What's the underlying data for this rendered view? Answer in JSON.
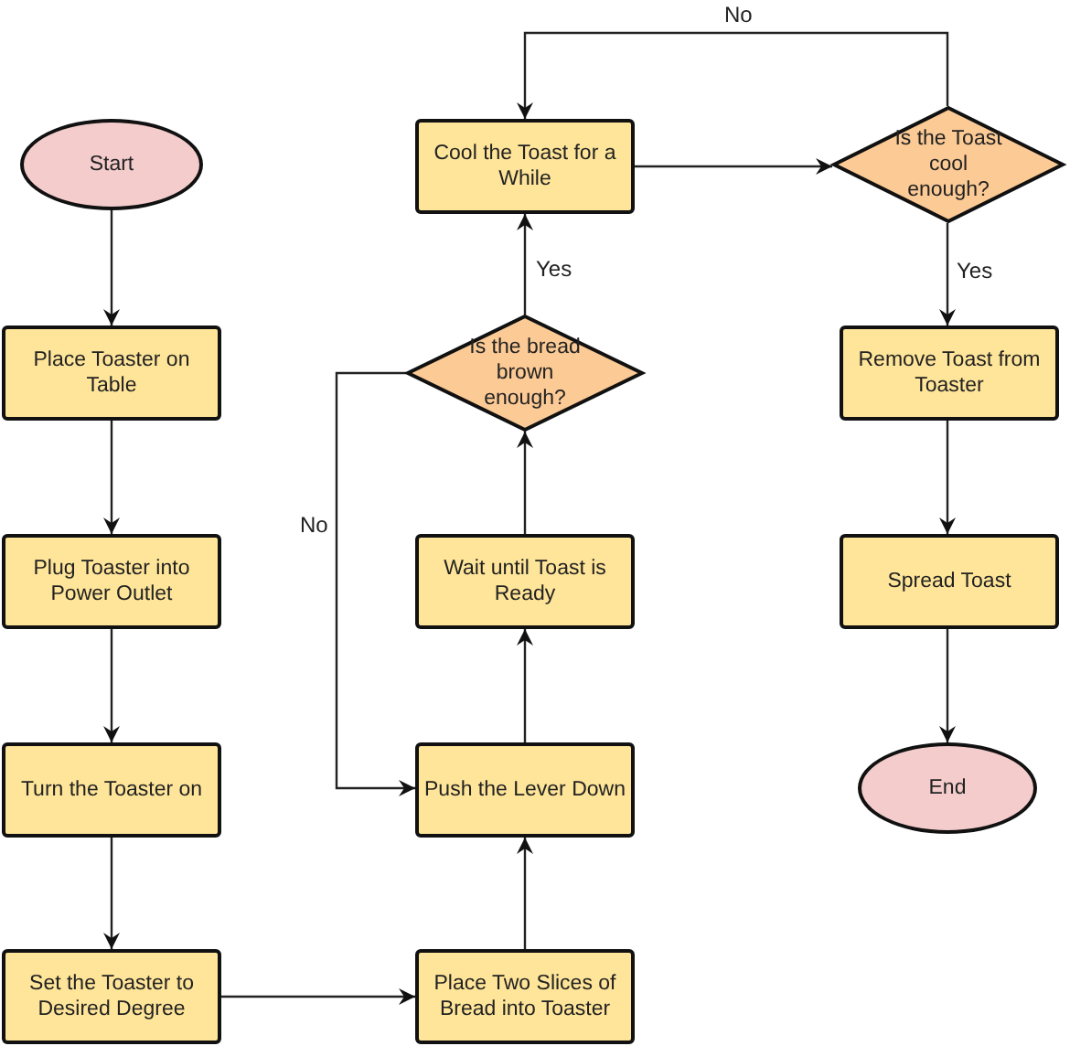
{
  "nodes": [
    {
      "kind": "terminal",
      "label": "Start"
    },
    {
      "kind": "process",
      "label": "Cool the Toast for a While"
    },
    {
      "kind": "decision",
      "label": "Is the Toast cool enough?"
    },
    {
      "kind": "process",
      "label": "Place Toaster on Table"
    },
    {
      "kind": "decision",
      "label": "Is the bread brown enough?"
    },
    {
      "kind": "process",
      "label": "Remove Toast from Toaster"
    },
    {
      "kind": "process",
      "label": "Plug Toaster into Power Outlet"
    },
    {
      "kind": "process",
      "label": "Wait until Toast is Ready"
    },
    {
      "kind": "process",
      "label": "Spread Toast"
    },
    {
      "kind": "process",
      "label": "Turn the Toaster on"
    },
    {
      "kind": "process",
      "label": "Push the Lever Down"
    },
    {
      "kind": "terminal",
      "label": "End"
    },
    {
      "kind": "process",
      "label": "Set the Toaster to Desired Degree"
    },
    {
      "kind": "process",
      "label": "Place Two Slices of Bread into Toaster"
    }
  ],
  "branch_labels": [
    {
      "text": "No"
    },
    {
      "text": "Yes"
    },
    {
      "text": "Yes"
    },
    {
      "text": "No"
    }
  ]
}
